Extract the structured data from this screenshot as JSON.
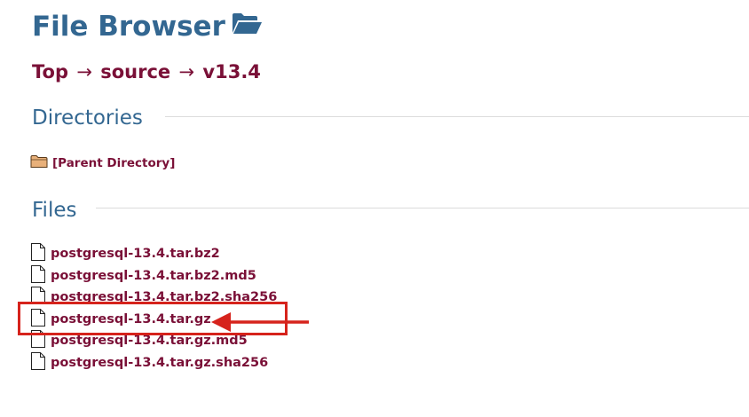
{
  "page": {
    "title": "File Browser",
    "title_icon": "open-folder-icon"
  },
  "breadcrumb": {
    "items": [
      "Top",
      "source",
      "v13.4"
    ],
    "separator": "→"
  },
  "sections": {
    "directories": {
      "title": "Directories",
      "items": [
        {
          "label": "[Parent Directory]",
          "icon": "folder-icon"
        }
      ]
    },
    "files": {
      "title": "Files",
      "items": [
        {
          "label": "postgresql-13.4.tar.bz2",
          "icon": "file-icon"
        },
        {
          "label": "postgresql-13.4.tar.bz2.md5",
          "icon": "file-icon"
        },
        {
          "label": "postgresql-13.4.tar.bz2.sha256",
          "icon": "file-icon"
        },
        {
          "label": "postgresql-13.4.tar.gz",
          "icon": "file-icon"
        },
        {
          "label": "postgresql-13.4.tar.gz.md5",
          "icon": "file-icon"
        },
        {
          "label": "postgresql-13.4.tar.gz.sha256",
          "icon": "file-icon"
        }
      ]
    }
  },
  "annotation": {
    "highlight_color": "#d6231c",
    "highlighted_item": "postgresql-13.4.tar.gz"
  },
  "colors": {
    "heading": "#336791",
    "link": "#7a1037",
    "folder": "#e8b07a"
  }
}
